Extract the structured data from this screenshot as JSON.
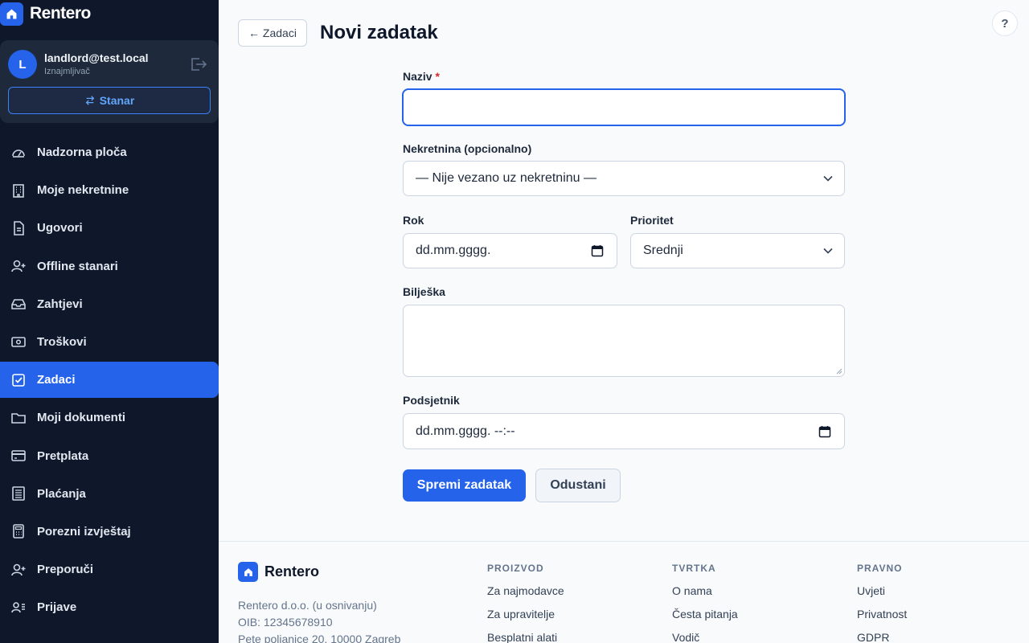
{
  "brand": {
    "name": "Rentero"
  },
  "user": {
    "initial": "L",
    "email": "landlord@test.local",
    "role": "Iznajmljivač",
    "switch_label": "Stanar"
  },
  "nav": [
    {
      "label": "Nadzorna ploča",
      "icon": "dashboard-icon",
      "active": false
    },
    {
      "label": "Moje nekretnine",
      "icon": "building-icon",
      "active": false
    },
    {
      "label": "Ugovori",
      "icon": "document-icon",
      "active": false
    },
    {
      "label": "Offline stanari",
      "icon": "user-plus-icon",
      "active": false
    },
    {
      "label": "Zahtjevi",
      "icon": "inbox-icon",
      "active": false
    },
    {
      "label": "Troškovi",
      "icon": "cash-icon",
      "active": false
    },
    {
      "label": "Zadaci",
      "icon": "checklist-icon",
      "active": true
    },
    {
      "label": "Moji dokumenti",
      "icon": "folder-icon",
      "active": false
    },
    {
      "label": "Pretplata",
      "icon": "credit-card-icon",
      "active": false
    },
    {
      "label": "Plaćanja",
      "icon": "receipt-icon",
      "active": false
    },
    {
      "label": "Porezni izvještaj",
      "icon": "calculator-icon",
      "active": false
    },
    {
      "label": "Preporuči",
      "icon": "user-add-icon",
      "active": false
    },
    {
      "label": "Prijave",
      "icon": "user-list-icon",
      "active": false
    }
  ],
  "header": {
    "back_label": "← Zadaci",
    "title": "Novi zadatak",
    "help_label": "?"
  },
  "form": {
    "name_label": "Naziv",
    "name_required": "*",
    "name_value": "",
    "property_label": "Nekretnina (opcionalno)",
    "property_value": "— Nije vezano uz nekretninu —",
    "due_label": "Rok",
    "due_placeholder": "dd.mm.gggg.",
    "priority_label": "Prioritet",
    "priority_value": "Srednji",
    "note_label": "Bilješka",
    "note_value": "",
    "reminder_label": "Podsjetnik",
    "reminder_placeholder": "dd.mm.gggg. --:--",
    "save_label": "Spremi zadatak",
    "cancel_label": "Odustani"
  },
  "footer": {
    "brand": "Rentero",
    "company": "Rentero d.o.o. (u osnivanju)",
    "oib": "OIB: 12345678910",
    "address": "Pete poljanice 20, 10000 Zagreb",
    "columns": [
      {
        "heading": "PROIZVOD",
        "links": [
          "Za najmodavce",
          "Za upravitelje",
          "Besplatni alati"
        ]
      },
      {
        "heading": "TVRTKA",
        "links": [
          "O nama",
          "Česta pitanja",
          "Vodič"
        ]
      },
      {
        "heading": "PRAVNO",
        "links": [
          "Uvjeti",
          "Privatnost",
          "GDPR"
        ]
      }
    ]
  },
  "colors": {
    "accent": "#2563eb",
    "sidebar": "#0f172a",
    "required": "#dc2626"
  }
}
